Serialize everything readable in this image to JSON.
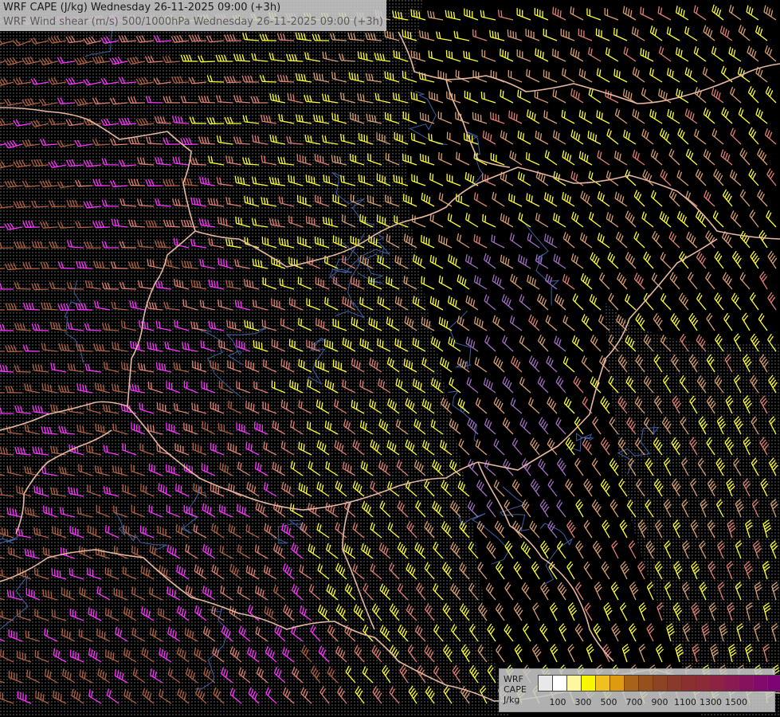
{
  "header": {
    "line1": "WRF CAPE (J/kg) Wednesday 26-11-2025 09:00 (+3h)",
    "line2": "WRF Wind shear (m/s) 500/1000hPa Wednesday 26-11-2025 09:00 (+3h)"
  },
  "legend": {
    "model": "WRF",
    "variable": "CAPE",
    "unit": "J/kg",
    "swatch_colors": [
      "#e8e8e8",
      "#ffffff",
      "#fff7a0",
      "#f7f700",
      "#f0c020",
      "#e09a10",
      "#a8621a",
      "#96501e",
      "#8c4424",
      "#8a3a2a",
      "#8a3030",
      "#8c2a38",
      "#8c2244",
      "#8a1a52",
      "#86125e",
      "#820a6a",
      "#7c0474"
    ],
    "tick_labels": [
      "100",
      "300",
      "500",
      "700",
      "900",
      "1100",
      "1300",
      "1500"
    ]
  },
  "map": {
    "barb_colors": [
      "#d8a070",
      "#ffff33",
      "#e08070",
      "#ff33ff",
      "#b06040",
      "#a070c0"
    ],
    "border_color": "#e8b8a0",
    "river_color": "#4060a0"
  }
}
